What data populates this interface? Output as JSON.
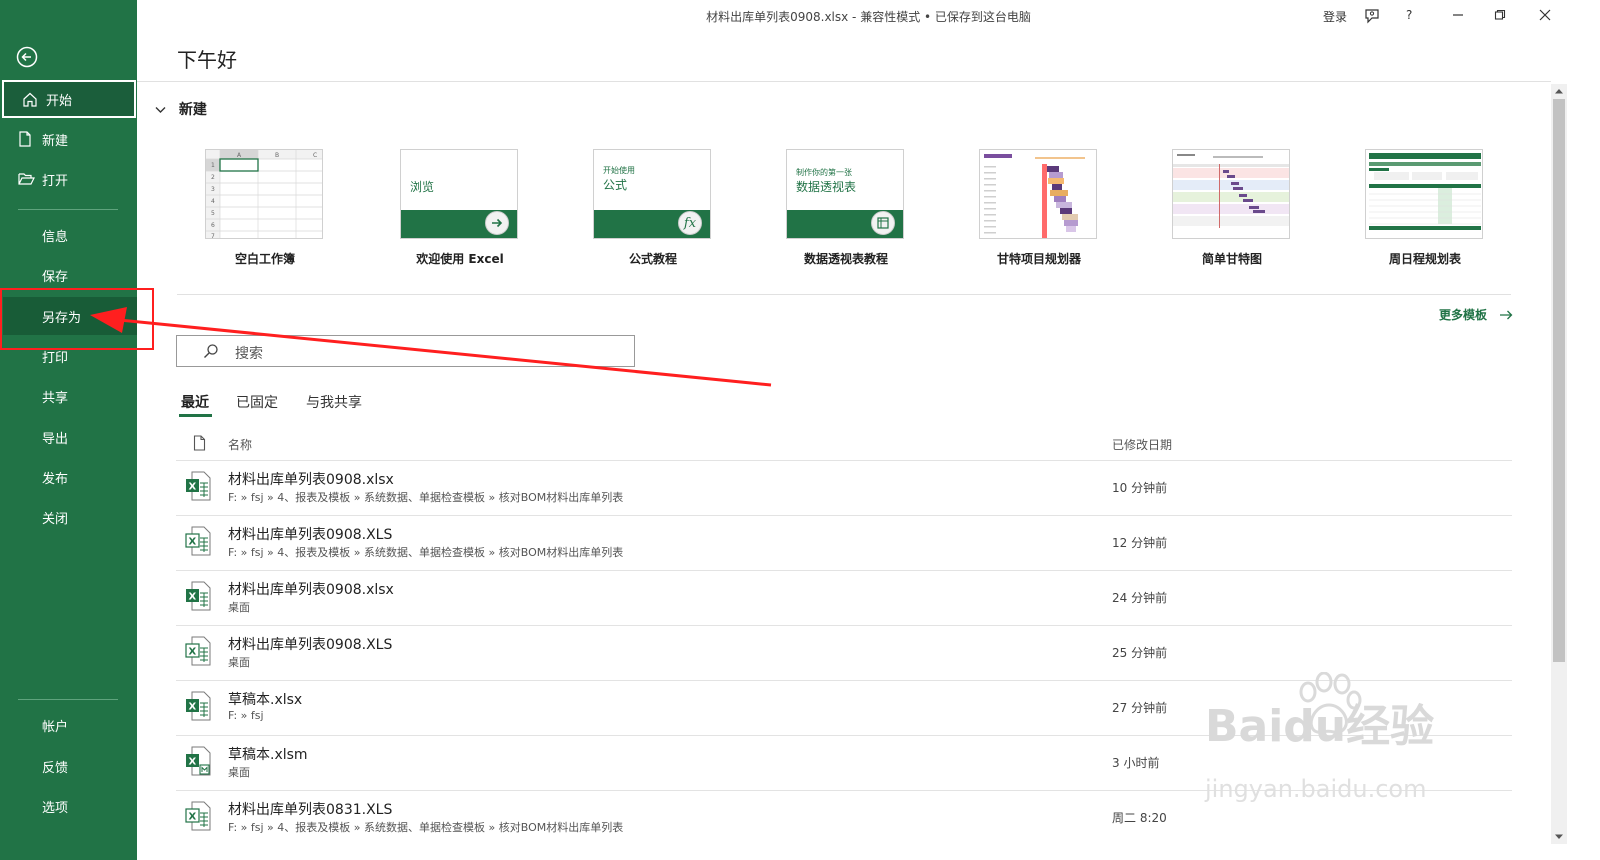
{
  "window": {
    "title": "材料出库单列表0908.xlsx  -  兼容性模式 • 已保存到这台电脑",
    "signin": "登录",
    "help": "?"
  },
  "sidebar": {
    "items": [
      {
        "label": "开始",
        "icon": "home-icon"
      },
      {
        "label": "新建",
        "icon": "new-file-icon"
      },
      {
        "label": "打开",
        "icon": "open-folder-icon"
      },
      {
        "label": "信息"
      },
      {
        "label": "保存"
      },
      {
        "label": "另存为"
      },
      {
        "label": "打印"
      },
      {
        "label": "共享"
      },
      {
        "label": "导出"
      },
      {
        "label": "发布"
      },
      {
        "label": "关闭"
      }
    ],
    "bottom": [
      {
        "label": "帐户"
      },
      {
        "label": "反馈"
      },
      {
        "label": "选项"
      }
    ]
  },
  "main": {
    "greeting": "下午好",
    "new_section": "新建",
    "templates": [
      {
        "label": "空白工作簿"
      },
      {
        "label": "欢迎使用 Excel",
        "thumb_text": "浏览"
      },
      {
        "label": "公式教程",
        "thumb_text_small": "开始使用",
        "thumb_text": "公式"
      },
      {
        "label": "数据透视表教程",
        "thumb_text_small": "制作你的第一张",
        "thumb_text": "数据透视表"
      },
      {
        "label": "甘特项目规划器"
      },
      {
        "label": "简单甘特图"
      },
      {
        "label": "周日程规划表"
      }
    ],
    "more_templates": "更多模板",
    "search_placeholder": "搜索",
    "tabs": [
      "最近",
      "已固定",
      "与我共享"
    ],
    "columns": {
      "name": "名称",
      "modified": "已修改日期"
    },
    "files": [
      {
        "name": "材料出库单列表0908.xlsx",
        "path": "F: » fsj » 4、报表及模板 » 系统数据、单据检查模板 » 核对BOM材料出库单列表",
        "date": "10 分钟前",
        "type": "xlsx"
      },
      {
        "name": "材料出库单列表0908.XLS",
        "path": "F: » fsj » 4、报表及模板 » 系统数据、单据检查模板 » 核对BOM材料出库单列表",
        "date": "12 分钟前",
        "type": "xls"
      },
      {
        "name": "材料出库单列表0908.xlsx",
        "path": "桌面",
        "date": "24 分钟前",
        "type": "xlsx"
      },
      {
        "name": "材料出库单列表0908.XLS",
        "path": "桌面",
        "date": "25 分钟前",
        "type": "xls"
      },
      {
        "name": "草稿本.xlsx",
        "path": "F: » fsj",
        "date": "27 分钟前",
        "type": "xlsx"
      },
      {
        "name": "草稿本.xlsm",
        "path": "桌面",
        "date": "3 小时前",
        "type": "xlsm"
      },
      {
        "name": "材料出库单列表0831.XLS",
        "path": "F: » fsj » 4、报表及模板 » 系统数据、单据检查模板 » 核对BOM材料出库单列表",
        "date": "周二 8:20",
        "type": "xls"
      }
    ]
  },
  "watermark": {
    "text": "Baidu经验",
    "sub": "jingyan.baidu.com"
  },
  "colors": {
    "accent": "#217346",
    "annotation": "#ff1f1f"
  }
}
